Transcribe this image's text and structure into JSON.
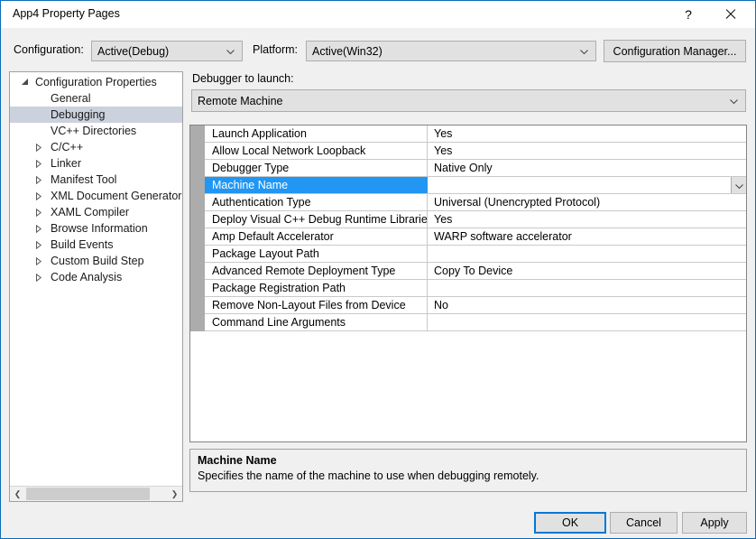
{
  "window": {
    "title": "App4 Property Pages",
    "help_label": "?",
    "close_label": "close-icon",
    "accent_color": "#0b6cb5"
  },
  "configbar": {
    "configuration_label": "Configuration:",
    "configuration_value": "Active(Debug)",
    "platform_label": "Platform:",
    "platform_value": "Active(Win32)",
    "config_manager_label": "Configuration Manager..."
  },
  "tree": {
    "items": [
      {
        "label": "Configuration Properties",
        "level": 0,
        "state": "expanded",
        "selected": false
      },
      {
        "label": "General",
        "level": 1,
        "state": "leaf",
        "selected": false
      },
      {
        "label": "Debugging",
        "level": 1,
        "state": "leaf",
        "selected": true
      },
      {
        "label": "VC++ Directories",
        "level": 1,
        "state": "leaf",
        "selected": false
      },
      {
        "label": "C/C++",
        "level": 1,
        "state": "collapsed",
        "selected": false
      },
      {
        "label": "Linker",
        "level": 1,
        "state": "collapsed",
        "selected": false
      },
      {
        "label": "Manifest Tool",
        "level": 1,
        "state": "collapsed",
        "selected": false
      },
      {
        "label": "XML Document Generator",
        "level": 1,
        "state": "collapsed",
        "selected": false
      },
      {
        "label": "XAML Compiler",
        "level": 1,
        "state": "collapsed",
        "selected": false
      },
      {
        "label": "Browse Information",
        "level": 1,
        "state": "collapsed",
        "selected": false
      },
      {
        "label": "Build Events",
        "level": 1,
        "state": "collapsed",
        "selected": false
      },
      {
        "label": "Custom Build Step",
        "level": 1,
        "state": "collapsed",
        "selected": false
      },
      {
        "label": "Code Analysis",
        "level": 1,
        "state": "collapsed",
        "selected": false
      }
    ],
    "scroll_left_label": "❮",
    "scroll_right_label": "❯"
  },
  "main": {
    "debugger_to_launch_label": "Debugger to launch:",
    "debugger_value": "Remote Machine",
    "properties": [
      {
        "name": "Launch Application",
        "value": "Yes",
        "selected": false,
        "dropdown": false
      },
      {
        "name": "Allow Local Network Loopback",
        "value": "Yes",
        "selected": false,
        "dropdown": false
      },
      {
        "name": "Debugger Type",
        "value": "Native Only",
        "selected": false,
        "dropdown": false
      },
      {
        "name": "Machine Name",
        "value": "",
        "selected": true,
        "dropdown": true
      },
      {
        "name": "Authentication Type",
        "value": "Universal (Unencrypted Protocol)",
        "selected": false,
        "dropdown": false
      },
      {
        "name": "Deploy Visual C++ Debug Runtime Libraries",
        "value": "Yes",
        "selected": false,
        "dropdown": false
      },
      {
        "name": "Amp Default Accelerator",
        "value": "WARP software accelerator",
        "selected": false,
        "dropdown": false
      },
      {
        "name": "Package Layout Path",
        "value": "",
        "selected": false,
        "dropdown": false
      },
      {
        "name": "Advanced Remote Deployment Type",
        "value": "Copy To Device",
        "selected": false,
        "dropdown": false
      },
      {
        "name": "Package Registration Path",
        "value": "",
        "selected": false,
        "dropdown": false
      },
      {
        "name": "Remove Non-Layout Files from Device",
        "value": "No",
        "selected": false,
        "dropdown": false
      },
      {
        "name": "Command Line Arguments",
        "value": "",
        "selected": false,
        "dropdown": false
      }
    ]
  },
  "description": {
    "title": "Machine Name",
    "body": "Specifies the name of the machine to use when debugging remotely."
  },
  "footer": {
    "ok_label": "OK",
    "cancel_label": "Cancel",
    "apply_label": "Apply"
  }
}
